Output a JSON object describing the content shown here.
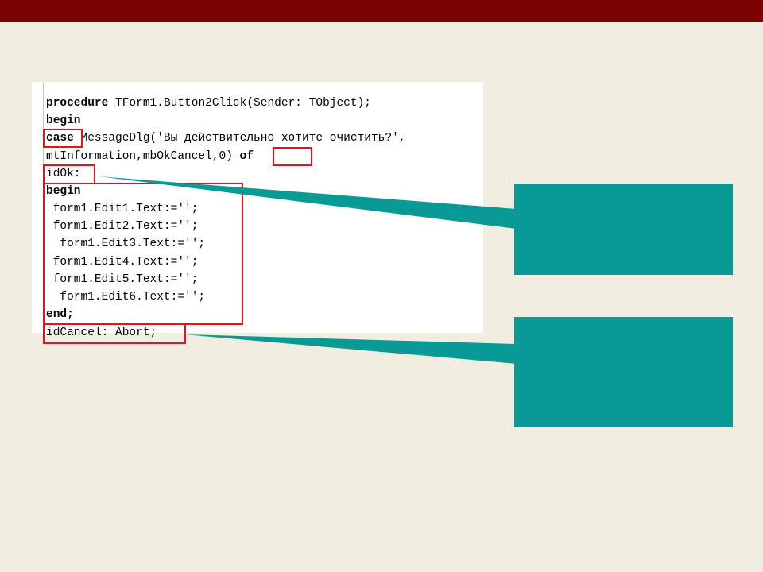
{
  "code": {
    "lines": [
      {
        "keyword": "procedure",
        "text": " TForm1.Button2Click(Sender: TObject);"
      },
      {
        "keyword": "begin",
        "text": ""
      },
      {
        "keyword": "case",
        "text": " MessageDlg('Вы действительно хотите очистить?',"
      },
      {
        "keyword": "",
        "text": "mtInformation,mbOkCancel,0) "
      },
      {
        "keyword": "",
        "text": "idOk:"
      },
      {
        "keyword": "begin",
        "text": ""
      },
      {
        "keyword": "",
        "text": " form1.Edit1.Text:='';"
      },
      {
        "keyword": "",
        "text": " form1.Edit2.Text:='';"
      },
      {
        "keyword": "",
        "text": "  form1.Edit3.Text:='';"
      },
      {
        "keyword": "",
        "text": " form1.Edit4.Text:='';"
      },
      {
        "keyword": "",
        "text": " form1.Edit5.Text:='';"
      },
      {
        "keyword": "",
        "text": "  form1.Edit6.Text:='';"
      },
      {
        "keyword": "end;",
        "text": ""
      },
      {
        "keyword": "",
        "text": "idCancel: Abort;"
      }
    ],
    "of_keyword": "of"
  },
  "colors": {
    "top_bar": "#7b0000",
    "background": "#f1ede0",
    "highlight_border": "#e3131b",
    "callout": "#0a9a95"
  }
}
